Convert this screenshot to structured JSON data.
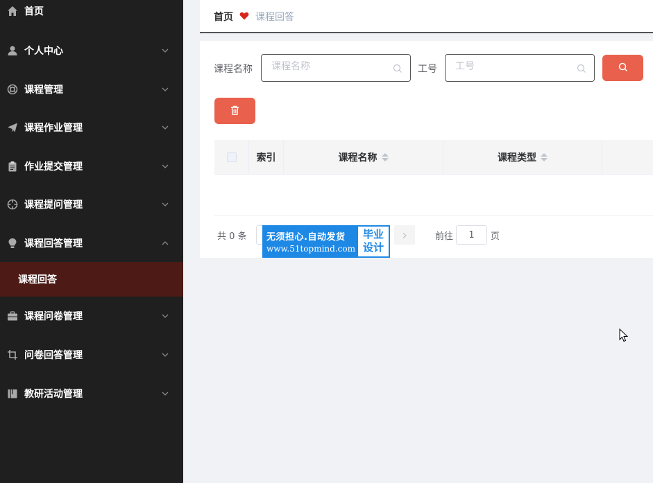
{
  "sidebar": {
    "items": [
      {
        "label": "首页",
        "icon": "home-icon"
      },
      {
        "label": "个人中心",
        "icon": "user-icon"
      },
      {
        "label": "课程管理",
        "icon": "lifebuoy-icon"
      },
      {
        "label": "课程作业管理",
        "icon": "paper-plane-icon"
      },
      {
        "label": "作业提交管理",
        "icon": "clipboard-icon"
      },
      {
        "label": "课程提问管理",
        "icon": "crosshair-icon"
      },
      {
        "label": "课程回答管理",
        "icon": "lightbulb-icon"
      },
      {
        "label": "课程问卷管理",
        "icon": "briefcase-icon"
      },
      {
        "label": "问卷回答管理",
        "icon": "crop-icon"
      },
      {
        "label": "教研活动管理",
        "icon": "book-icon"
      }
    ],
    "active_sub": "课程回答"
  },
  "breadcrumb": {
    "home": "首页",
    "current": "课程回答"
  },
  "search": {
    "course_label": "课程名称",
    "course_placeholder": "课程名称",
    "staff_label": "工号",
    "staff_placeholder": "工号"
  },
  "table": {
    "columns": [
      "索引",
      "课程名称",
      "课程类型"
    ]
  },
  "pagination": {
    "total": "共 0 条",
    "goto": "前往",
    "page_value": "1",
    "page_suffix": "页"
  },
  "watermark": {
    "line1": "无须担心.自动发货",
    "line2": "www.51topmind.com",
    "right1": "毕业",
    "right2": "设计"
  },
  "colors": {
    "sidebar_bg": "#1f1f1f",
    "active_bg": "#4d1a15",
    "accent": "#e9614c",
    "heart": "#d9261c",
    "watermark_blue": "#1e88e5"
  }
}
